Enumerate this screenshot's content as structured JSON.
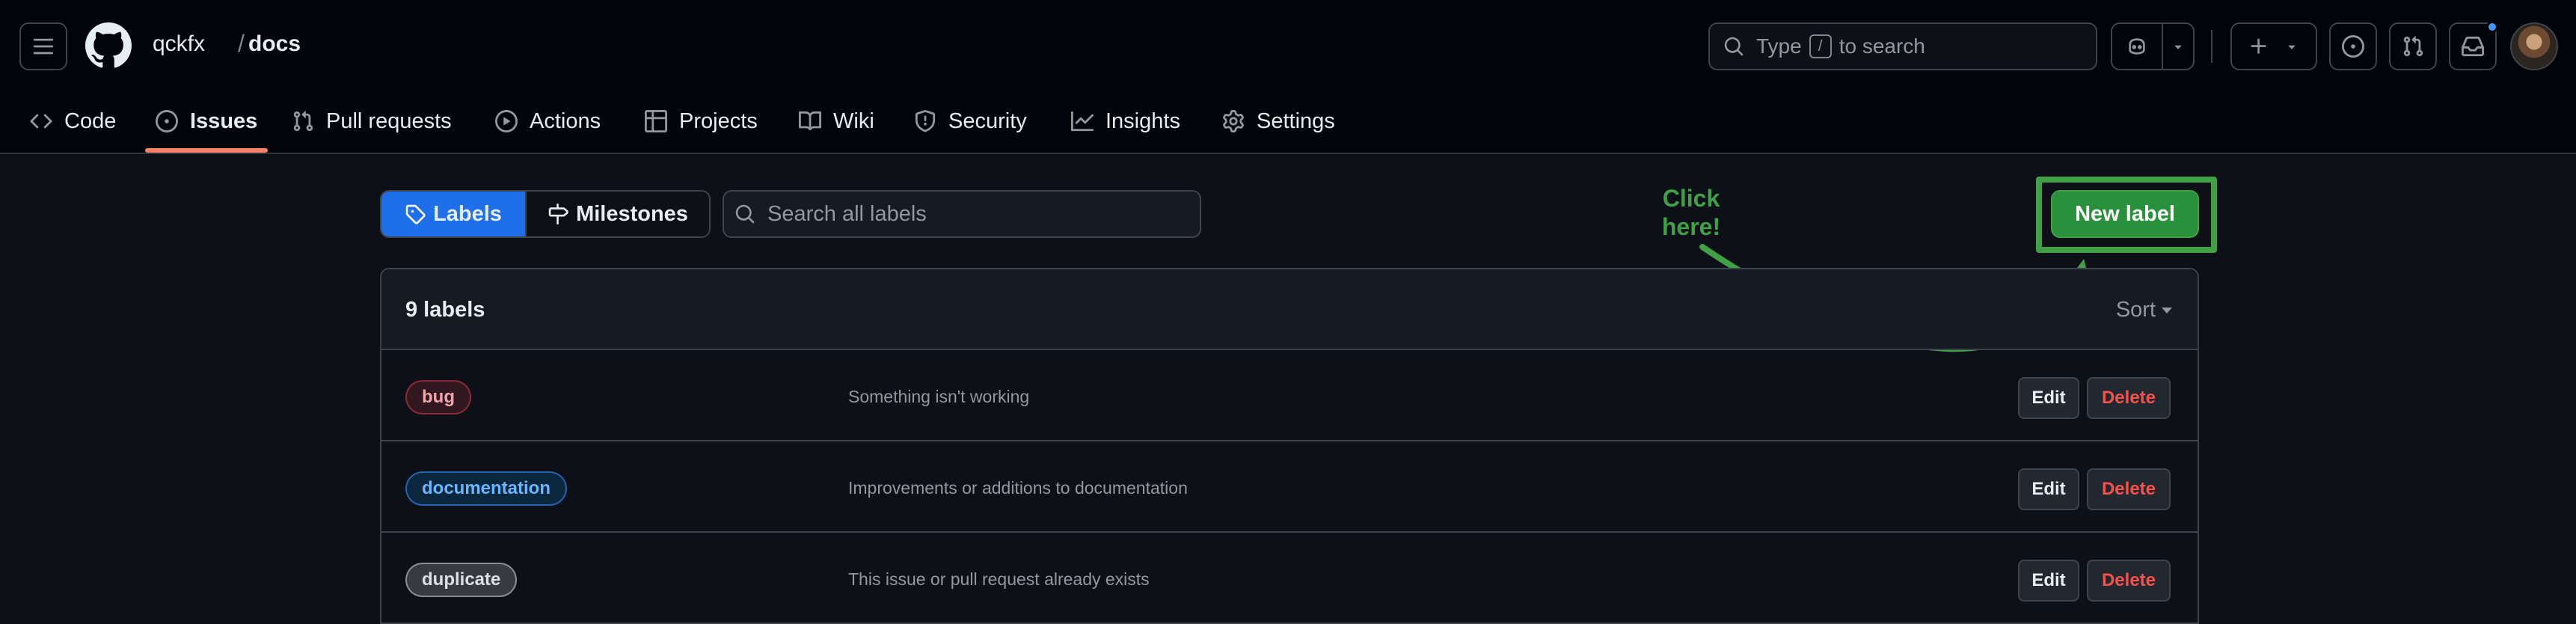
{
  "breadcrumb": {
    "owner": "qckfx",
    "separator": "/",
    "repo": "docs"
  },
  "search": {
    "prefix": "Type",
    "key": "/",
    "suffix": "to search"
  },
  "nav": {
    "code": "Code",
    "issues": "Issues",
    "pull_requests": "Pull requests",
    "actions": "Actions",
    "projects": "Projects",
    "wiki": "Wiki",
    "security": "Security",
    "insights": "Insights",
    "settings": "Settings"
  },
  "subnav": {
    "labels": "Labels",
    "milestones": "Milestones"
  },
  "label_search": {
    "placeholder": "Search all labels"
  },
  "annotation": {
    "line1": "Click",
    "line2": "here!",
    "color": "#3fa046"
  },
  "new_label_button": "New label",
  "labels_box": {
    "count": "9 labels",
    "sort": "Sort",
    "edit_label": "Edit",
    "delete_label": "Delete",
    "rows": [
      {
        "name": "bug",
        "description": "Something isn't working",
        "color": "#d73a4a"
      },
      {
        "name": "documentation",
        "description": "Improvements or additions to documentation",
        "color": "#0075ca"
      },
      {
        "name": "duplicate",
        "description": "This issue or pull request already exists",
        "color": "#cfd3d7"
      }
    ]
  },
  "colors": {
    "accent_blue": "#1f6feb",
    "success_green": "#29903b",
    "danger_red": "#f85149",
    "active_underline": "#f78166"
  }
}
